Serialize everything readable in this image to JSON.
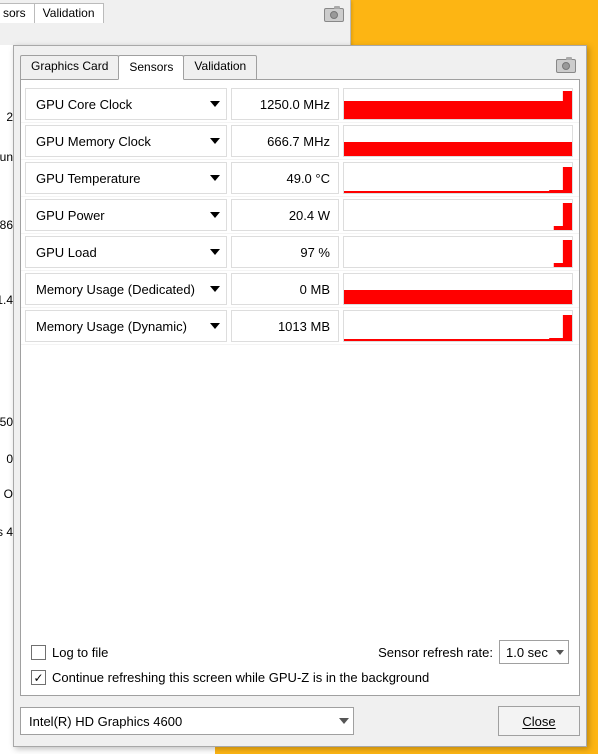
{
  "background_tabs": {
    "t1": "sors",
    "t2": "Validation"
  },
  "tabs": {
    "graphics": "Graphics Card",
    "sensors": "Sensors",
    "validation": "Validation"
  },
  "sensors": [
    {
      "name": "GPU Core Clock",
      "value": "1250.0 MHz",
      "spark": "flat-high"
    },
    {
      "name": "GPU Memory Clock",
      "value": "666.7 MHz",
      "spark": "flat-mid"
    },
    {
      "name": "GPU Temperature",
      "value": "49.0 °C",
      "spark": "low-spike"
    },
    {
      "name": "GPU Power",
      "value": "20.4 W",
      "spark": "right-spike"
    },
    {
      "name": "GPU Load",
      "value": "97 %",
      "spark": "right-spike"
    },
    {
      "name": "Memory Usage (Dedicated)",
      "value": "0 MB",
      "spark": "flat-mid"
    },
    {
      "name": "Memory Usage (Dynamic)",
      "value": "1013 MB",
      "spark": "low-spike"
    }
  ],
  "log_to_file": {
    "label": "Log to file",
    "checked": false
  },
  "refresh": {
    "label": "Sensor refresh rate:",
    "value": "1.0 sec"
  },
  "bg_refresh": {
    "label": "Continue refreshing this screen while GPU-Z is in the background",
    "checked": true
  },
  "gpu_select": "Intel(R) HD Graphics 4600",
  "close": "Close",
  "left_fragments": {
    "a": "2",
    "b": "un",
    "c": "86",
    "d": "1.4",
    "e": "50",
    "f": "0",
    "g": "O",
    "h": "s 4"
  }
}
